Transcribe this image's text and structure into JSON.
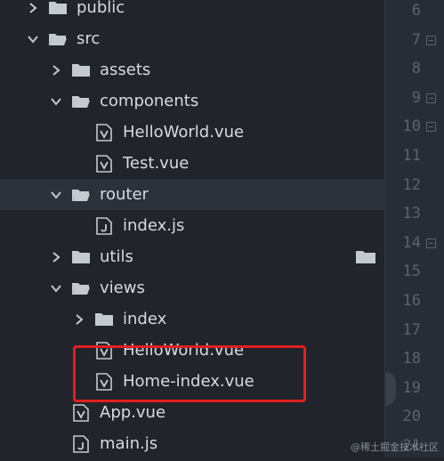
{
  "explorer": {
    "items": [
      {
        "label": "public",
        "type": "folder",
        "expanded": false,
        "depth": 0
      },
      {
        "label": "src",
        "type": "folder",
        "expanded": true,
        "depth": 0
      },
      {
        "label": "assets",
        "type": "folder",
        "expanded": false,
        "depth": 1
      },
      {
        "label": "components",
        "type": "folder",
        "expanded": true,
        "depth": 1
      },
      {
        "label": "HelloWorld.vue",
        "type": "file",
        "ext": "vue",
        "depth": 2
      },
      {
        "label": "Test.vue",
        "type": "file",
        "ext": "vue",
        "depth": 2
      },
      {
        "label": "router",
        "type": "folder",
        "expanded": true,
        "depth": 1,
        "selected": true
      },
      {
        "label": "index.js",
        "type": "file",
        "ext": "js",
        "depth": 2
      },
      {
        "label": "utils",
        "type": "folder",
        "expanded": false,
        "depth": 1
      },
      {
        "label": "views",
        "type": "folder",
        "expanded": true,
        "depth": 1
      },
      {
        "label": "index",
        "type": "folder",
        "expanded": false,
        "depth": 2
      },
      {
        "label": "HelloWorld.vue",
        "type": "file",
        "ext": "vue",
        "depth": 2
      },
      {
        "label": "Home-index.vue",
        "type": "file",
        "ext": "vue",
        "depth": 2
      },
      {
        "label": "App.vue",
        "type": "file",
        "ext": "vue",
        "depth": 1
      },
      {
        "label": "main.js",
        "type": "file",
        "ext": "js",
        "depth": 1
      }
    ]
  },
  "gutter": {
    "line_numbers": [
      "6",
      "7",
      "8",
      "9",
      "10",
      "11",
      "12",
      "13",
      "14",
      "15",
      "16",
      "17",
      "18",
      "19",
      "20",
      "21"
    ],
    "fold_lines": [
      "7",
      "9",
      "10",
      "14"
    ]
  },
  "watermark": "@稀土掘金技术社区",
  "colors": {
    "sidebar_bg": "#21252b",
    "selected_row_bg": "#2c313a",
    "text": "#d7dae0",
    "icon": "#c5c9d0",
    "gutter_bg": "#282c34",
    "line_number": "#5c6370",
    "highlight_border": "#e02020"
  }
}
